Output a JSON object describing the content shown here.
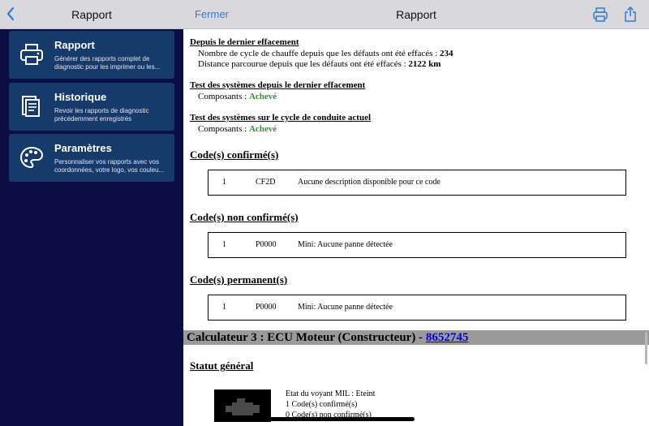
{
  "sidebar": {
    "title": "Rapport",
    "items": [
      {
        "title": "Rapport",
        "description": "Générer des rapports complet de diagnostic pour les imprimer ou les...",
        "icon": "printer-icon"
      },
      {
        "title": "Historique",
        "description": "Revoir les rapports de diagnostic précédemment enregistrés",
        "icon": "history-icon"
      },
      {
        "title": "Paramètres",
        "description": "Personnaliser vos rapports avec vos coordonnées, votre logo, vos couleu...",
        "icon": "palette-icon"
      }
    ]
  },
  "header": {
    "close_label": "Fermer",
    "title": "Rapport",
    "print_icon": "print-icon",
    "share_icon": "share-icon"
  },
  "report": {
    "since_reset": {
      "heading": "Depuis le dernier effacement",
      "cycles_label": "Nombre de cycle de chauffe depuis que les défauts ont été effacés : ",
      "cycles_value": "234",
      "distance_label": "Distance parcourue depuis que les défauts ont été effacés : ",
      "distance_value": "2122 km"
    },
    "test_since_reset": {
      "heading": "Test des systèmes depuis le dernier effacement",
      "label": "Composants : ",
      "value": "Achevé"
    },
    "test_current_cycle": {
      "heading": "Test des systèmes sur le cycle de conduite actuel",
      "label": "Composants : ",
      "value": "Achevé"
    },
    "confirmed": {
      "heading": "Code(s) confirmé(s)",
      "row": {
        "num": "1",
        "code": "CF2D",
        "desc": "Aucune description disponible pour ce code"
      }
    },
    "unconfirmed": {
      "heading": "Code(s) non confirmé(s)",
      "row": {
        "num": "1",
        "code": "P0000",
        "desc": "Mini: Aucune panne détectée"
      }
    },
    "permanent": {
      "heading": "Code(s) permanent(s)",
      "row": {
        "num": "1",
        "code": "P0000",
        "desc": "Mini: Aucune panne détectée"
      }
    },
    "calculator": {
      "title": "Calculateur 3 : ECU Moteur (Constructeur) - ",
      "link": "8652745"
    },
    "general_status": {
      "heading": "Statut général",
      "lines": [
        "Etat du voyant MIL : Eteint",
        "1 Code(s) confirmé(s)",
        "0 Code(s) non confirmé(s)"
      ]
    }
  },
  "colors": {
    "sidebar_bg": "#0b0d45",
    "card_bg": "#163a6a",
    "accent": "#2f7bd8",
    "success": "#2a9a2a",
    "link": "#0000ee"
  }
}
